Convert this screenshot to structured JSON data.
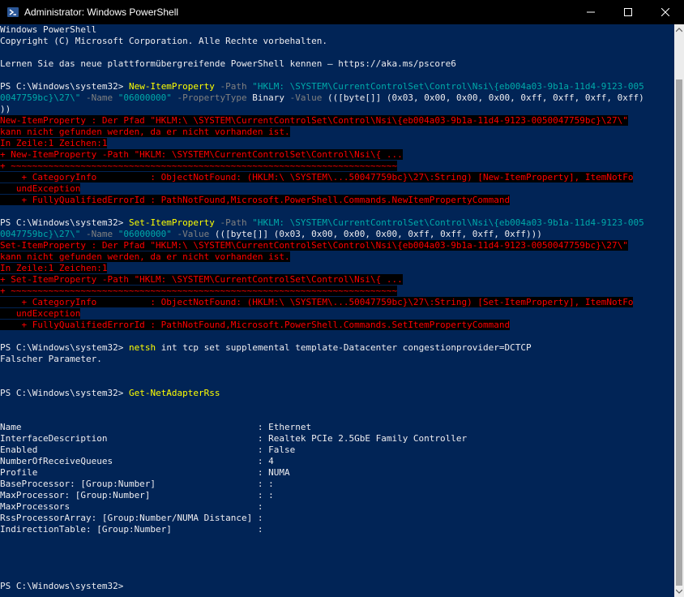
{
  "window": {
    "title": "Administrator: Windows PowerShell",
    "icons": {
      "app": "powershell-icon",
      "minimize": "minimize-icon",
      "maximize": "maximize-icon",
      "close": "close-icon"
    },
    "colors": {
      "console_bg": "#012456",
      "titlebar_bg": "#000000",
      "error_fg": "#ff0000",
      "error_bg": "#000000",
      "command": "#ffff00",
      "string": "#00aaaa",
      "parameter": "#808080"
    }
  },
  "console": {
    "lines": [
      [
        {
          "t": "Windows PowerShell",
          "c": "def"
        }
      ],
      [
        {
          "t": "Copyright (C) Microsoft Corporation. Alle Rechte vorbehalten.",
          "c": "def"
        }
      ],
      [
        {
          "t": "",
          "c": "def"
        }
      ],
      [
        {
          "t": "Lernen Sie das neue plattformübergreifende PowerShell kennen – https://aka.ms/pscore6",
          "c": "def"
        }
      ],
      [
        {
          "t": "",
          "c": "def"
        }
      ],
      [
        {
          "t": "PS C:\\Windows\\system32> ",
          "c": "def"
        },
        {
          "t": "New-ItemProperty",
          "c": "cmd"
        },
        {
          "t": " -Path ",
          "c": "param"
        },
        {
          "t": "\"HKLM: \\SYSTEM\\CurrentControlSet\\Control\\Nsi\\{eb004a03-9b1a-11d4-9123-005",
          "c": "str"
        }
      ],
      [
        {
          "t": "0047759bc}\\27\\\"",
          "c": "str"
        },
        {
          "t": " -Name ",
          "c": "param"
        },
        {
          "t": "\"06000000\"",
          "c": "str"
        },
        {
          "t": " -PropertyType ",
          "c": "param"
        },
        {
          "t": "Binary",
          "c": "def"
        },
        {
          "t": " -Value ",
          "c": "param"
        },
        {
          "t": "(([byte[]] (0x03, 0x00, 0x00, 0x00, 0xff, 0xff, 0xff, 0xff)",
          "c": "def"
        }
      ],
      [
        {
          "t": "))",
          "c": "def"
        }
      ],
      [
        {
          "t": "New-ItemProperty : Der Pfad \"HKLM:\\ \\SYSTEM\\CurrentControlSet\\Control\\Nsi\\{eb004a03-9b1a-11d4-9123-0050047759bc}\\27\\\"",
          "c": "err"
        }
      ],
      [
        {
          "t": "kann nicht gefunden werden, da er nicht vorhanden ist.",
          "c": "err"
        }
      ],
      [
        {
          "t": "In Zeile:1 Zeichen:1",
          "c": "err"
        }
      ],
      [
        {
          "t": "+ New-ItemProperty -Path \"HKLM: \\SYSTEM\\CurrentControlSet\\Control\\Nsi\\{ ...",
          "c": "err"
        }
      ],
      [
        {
          "t": "+ ~~~~~~~~~~~~~~~~~~~~~~~~~~~~~~~~~~~~~~~~~~~~~~~~~~~~~~~~~~~~~~~~~~~~~~~~",
          "c": "err"
        }
      ],
      [
        {
          "t": "    + CategoryInfo          : ObjectNotFound: (HKLM:\\ \\SYSTEM\\...50047759bc}\\27\\:String) [New-ItemProperty], ItemNotFo",
          "c": "err"
        }
      ],
      [
        {
          "t": "   undException",
          "c": "err"
        }
      ],
      [
        {
          "t": "    + FullyQualifiedErrorId : PathNotFound,Microsoft.PowerShell.Commands.NewItemPropertyCommand",
          "c": "err"
        }
      ],
      [
        {
          "t": "",
          "c": "def"
        }
      ],
      [
        {
          "t": "PS C:\\Windows\\system32> ",
          "c": "def"
        },
        {
          "t": "Set-ItemProperty",
          "c": "cmd"
        },
        {
          "t": " -Path ",
          "c": "param"
        },
        {
          "t": "\"HKLM: \\SYSTEM\\CurrentControlSet\\Control\\Nsi\\{eb004a03-9b1a-11d4-9123-005",
          "c": "str"
        }
      ],
      [
        {
          "t": "0047759bc}\\27\\\"",
          "c": "str"
        },
        {
          "t": " -Name ",
          "c": "param"
        },
        {
          "t": "\"06000000\"",
          "c": "str"
        },
        {
          "t": " -Value ",
          "c": "param"
        },
        {
          "t": "(([byte[]] (0x03, 0x00, 0x00, 0x00, 0xff, 0xff, 0xff, 0xff)))",
          "c": "def"
        }
      ],
      [
        {
          "t": "Set-ItemProperty : Der Pfad \"HKLM:\\ \\SYSTEM\\CurrentControlSet\\Control\\Nsi\\{eb004a03-9b1a-11d4-9123-0050047759bc}\\27\\\"",
          "c": "err"
        }
      ],
      [
        {
          "t": "kann nicht gefunden werden, da er nicht vorhanden ist.",
          "c": "err"
        }
      ],
      [
        {
          "t": "In Zeile:1 Zeichen:1",
          "c": "err"
        }
      ],
      [
        {
          "t": "+ Set-ItemProperty -Path \"HKLM: \\SYSTEM\\CurrentControlSet\\Control\\Nsi\\{ ...",
          "c": "err"
        }
      ],
      [
        {
          "t": "+ ~~~~~~~~~~~~~~~~~~~~~~~~~~~~~~~~~~~~~~~~~~~~~~~~~~~~~~~~~~~~~~~~~~~~~~~~",
          "c": "err"
        }
      ],
      [
        {
          "t": "    + CategoryInfo          : ObjectNotFound: (HKLM:\\ \\SYSTEM\\...50047759bc}\\27\\:String) [Set-ItemProperty], ItemNotFo",
          "c": "err"
        }
      ],
      [
        {
          "t": "   undException",
          "c": "err"
        }
      ],
      [
        {
          "t": "    + FullyQualifiedErrorId : PathNotFound,Microsoft.PowerShell.Commands.SetItemPropertyCommand",
          "c": "err"
        }
      ],
      [
        {
          "t": "",
          "c": "def"
        }
      ],
      [
        {
          "t": "PS C:\\Windows\\system32> ",
          "c": "def"
        },
        {
          "t": "netsh",
          "c": "cmd"
        },
        {
          "t": " int tcp set supplemental template-Datacenter congestionprovider=DCTCP",
          "c": "def"
        }
      ],
      [
        {
          "t": "Falscher Parameter.",
          "c": "def"
        }
      ],
      [
        {
          "t": "",
          "c": "def"
        }
      ],
      [
        {
          "t": "",
          "c": "def"
        }
      ],
      [
        {
          "t": "PS C:\\Windows\\system32> ",
          "c": "def"
        },
        {
          "t": "Get-NetAdapterRss",
          "c": "cmd"
        }
      ],
      [
        {
          "t": "",
          "c": "def"
        }
      ],
      [
        {
          "t": "",
          "c": "def"
        }
      ],
      [
        {
          "t": "Name                                            : Ethernet",
          "c": "def"
        }
      ],
      [
        {
          "t": "InterfaceDescription                            : Realtek PCIe 2.5GbE Family Controller",
          "c": "def"
        }
      ],
      [
        {
          "t": "Enabled                                         : False",
          "c": "def"
        }
      ],
      [
        {
          "t": "NumberOfReceiveQueues                           : 4",
          "c": "def"
        }
      ],
      [
        {
          "t": "Profile                                         : NUMA",
          "c": "def"
        }
      ],
      [
        {
          "t": "BaseProcessor: [Group:Number]                   : :",
          "c": "def"
        }
      ],
      [
        {
          "t": "MaxProcessor: [Group:Number]                    : :",
          "c": "def"
        }
      ],
      [
        {
          "t": "MaxProcessors                                   :",
          "c": "def"
        }
      ],
      [
        {
          "t": "RssProcessorArray: [Group:Number/NUMA Distance] :",
          "c": "def"
        }
      ],
      [
        {
          "t": "IndirectionTable: [Group:Number]                :",
          "c": "def"
        }
      ],
      [
        {
          "t": "",
          "c": "def"
        }
      ],
      [
        {
          "t": "",
          "c": "def"
        }
      ],
      [
        {
          "t": "",
          "c": "def"
        }
      ],
      [
        {
          "t": "",
          "c": "def"
        }
      ],
      [
        {
          "t": "PS C:\\Windows\\system32> ",
          "c": "def"
        }
      ]
    ]
  },
  "scrollbar": {
    "scroll_fraction": 1.0,
    "visible_fraction": 0.92
  }
}
